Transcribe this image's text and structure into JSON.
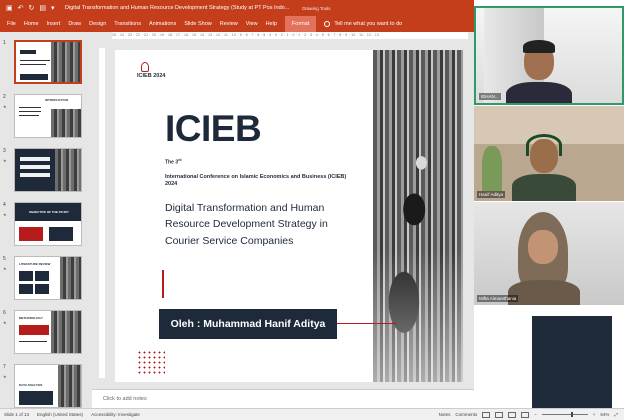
{
  "titlebar": {
    "doc_title": "Digital Transformation and Human Resource Development Strategy (Study at PT Pos Indo...",
    "context_tools": "Drawing Tools"
  },
  "menu": {
    "file": "File",
    "home": "Home",
    "insert": "Insert",
    "draw": "Draw",
    "design": "Design",
    "transitions": "Transitions",
    "animations": "Animations",
    "slideshow": "Slide Show",
    "review": "Review",
    "view": "View",
    "help": "Help",
    "format": "Format",
    "tellme": "Tell me what you want to do"
  },
  "thumbnails": {
    "nums": [
      "1",
      "2",
      "3",
      "4",
      "5",
      "6",
      "7"
    ],
    "t2_title": "INTRODUCTION",
    "t4_title": "OBJECTIVE OF THE STUDY",
    "t5_title": "LITERATURE REVIEW",
    "t6_title": "METHODOLOGY",
    "t7_title": "DATA ANALYSIS"
  },
  "ruler": "25 · 24 · 23 · 22 · 21 · 20 · 19 · 18 · 17 · 16 · 15 · 14 · 13 · 12 · 11 · 10 · 9 · 8 · 7 · 6 · 5 · 4 · 3 · 2 · 1 · 0 · 1 · 2 · 3 · 4 · 5 · 6 · 7 · 8 · 9 · 10 · 11 · 12 · 13",
  "slide": {
    "logo": "ICIEB 2024",
    "big_title": "ICIEB",
    "the": "The 3",
    "the_sup": "rd",
    "conference": "International Conference on Islamic Economics and Business (ICIEB)",
    "year": "2024",
    "subtitle": "Digital Transformation and Human Resource Development Strategy in Courier Service Companies",
    "author": "Oleh : Muhammad Hanif Aditya"
  },
  "notes_placeholder": "Click to add notes",
  "statusbar": {
    "slide_info": "Slide 1 of 13",
    "language": "English (United States)",
    "accessibility": "Accessibility: Investigate",
    "notes": "Notes",
    "comments": "Comments",
    "zoom": "64%",
    "zoom_level": 0.64
  },
  "participants": [
    {
      "name": "IEHAN..."
    },
    {
      "name": "Hanif Aditya"
    },
    {
      "name": "Mifta Almarethania"
    }
  ]
}
